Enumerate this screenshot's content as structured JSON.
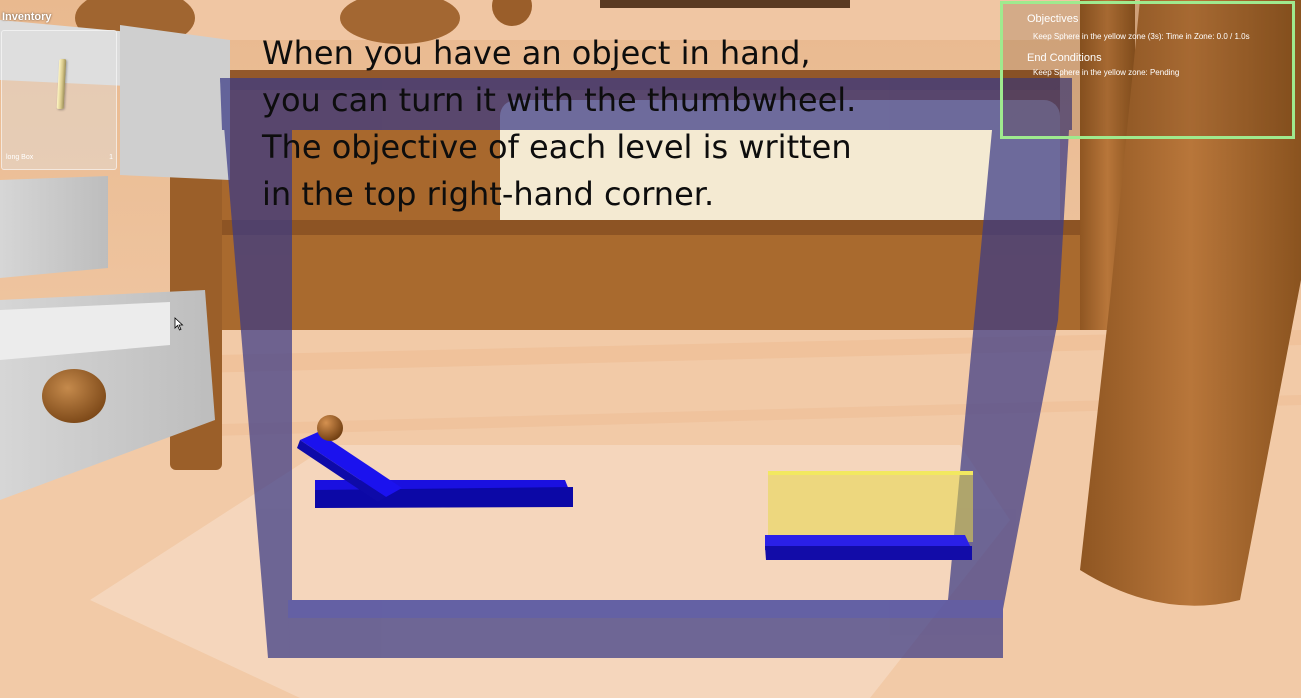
{
  "inventory": {
    "title": "Inventory",
    "slots": [
      {
        "name": "long Box",
        "count": "1"
      }
    ]
  },
  "tutorial": {
    "lines": [
      "When you have an object in hand,",
      "you can turn it with the thumbwheel.",
      "The objective of each level is written",
      "in the top right-hand corner."
    ]
  },
  "objectives": {
    "title": "Objectives",
    "items": [
      "Keep Sphere in the yellow zone (3s): Time in Zone: 0.0 / 1.0s"
    ],
    "end_conditions_title": "End Conditions",
    "end_conditions": [
      "Keep Sphere in the yellow zone: Pending"
    ]
  },
  "colors": {
    "objective_border": "#9fea8e",
    "frame": "#3a3a86",
    "ramp": "#1a10e0",
    "target_zone": "#e6d84a",
    "wood": "#a9692e",
    "floor": "#f1c9a6"
  }
}
